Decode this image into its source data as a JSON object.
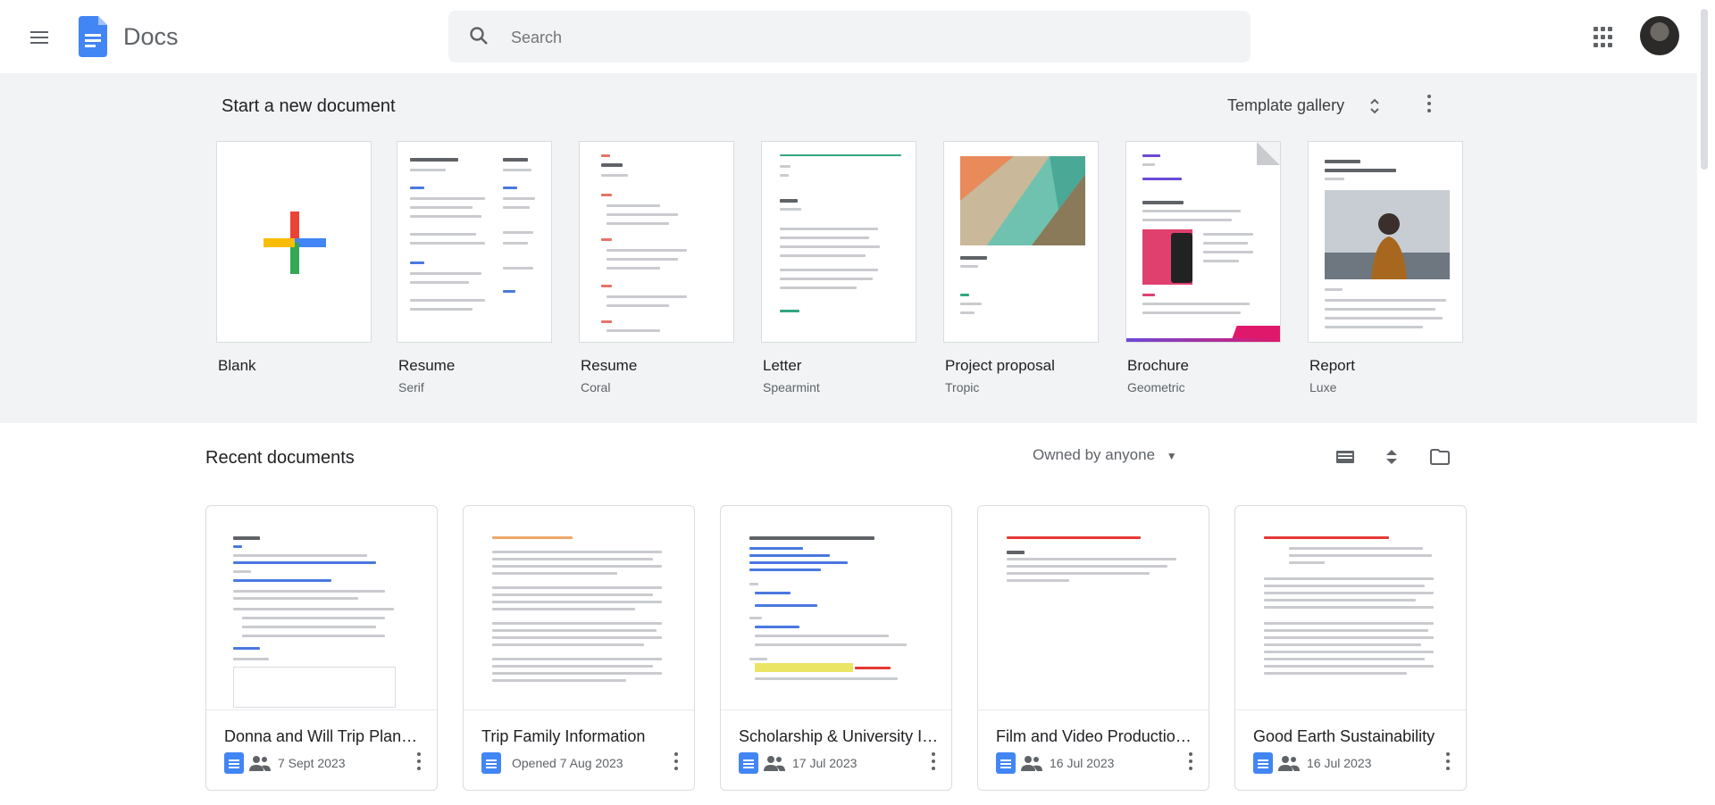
{
  "header": {
    "app_name": "Docs",
    "search_placeholder": "Search"
  },
  "templates": {
    "heading": "Start a new document",
    "gallery_label": "Template gallery",
    "items": [
      {
        "name": "Blank",
        "sub": ""
      },
      {
        "name": "Resume",
        "sub": "Serif"
      },
      {
        "name": "Resume",
        "sub": "Coral"
      },
      {
        "name": "Letter",
        "sub": "Spearmint"
      },
      {
        "name": "Project proposal",
        "sub": "Tropic"
      },
      {
        "name": "Brochure",
        "sub": "Geometric"
      },
      {
        "name": "Report",
        "sub": "Luxe"
      }
    ]
  },
  "recent": {
    "heading": "Recent documents",
    "owner_filter": "Owned by anyone",
    "docs": [
      {
        "title": "Donna and Will Trip Planning",
        "date": "7 Sept 2023"
      },
      {
        "title": "Trip Family Information",
        "date": "Opened 7 Aug 2023"
      },
      {
        "title": "Scholarship & University Information",
        "date": "17 Jul 2023"
      },
      {
        "title": "Film and Video Production Notes",
        "date": "16 Jul 2023"
      },
      {
        "title": "Good Earth Sustainability",
        "date": "16 Jul 2023"
      }
    ]
  },
  "colors": {
    "accent": "#4285f4",
    "template_bg": "#f1f3f4"
  }
}
